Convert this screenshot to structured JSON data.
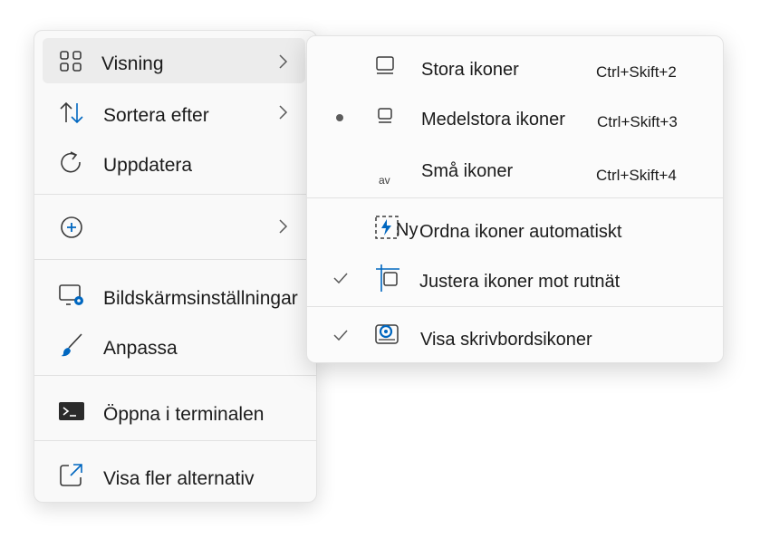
{
  "main_menu": {
    "items": [
      {
        "label": "Visning",
        "icon": "grid-icon",
        "submenu": true,
        "highlighted": true
      },
      {
        "label": "Sortera efter",
        "icon": "sort-arrows-icon",
        "submenu": true
      },
      {
        "label": "Uppdatera",
        "icon": "refresh-icon"
      },
      {
        "label": "",
        "icon": "plus-circle-icon",
        "submenu": true
      },
      {
        "label": "Bildskärmsinställningar",
        "icon": "display-settings-icon"
      },
      {
        "label": "Anpassa",
        "icon": "brush-icon"
      },
      {
        "label": "Öppna i terminalen",
        "icon": "terminal-icon"
      },
      {
        "label": "Visa fler alternativ",
        "icon": "external-link-icon"
      }
    ]
  },
  "sub_menu": {
    "items": [
      {
        "label": "Stora ikoner",
        "shortcut": "Ctrl+Skift+2",
        "icon": "large-icons-icon",
        "selected": false
      },
      {
        "label": "Medelstora ikoner",
        "shortcut": "Ctrl+Skift+3",
        "icon": "medium-icons-icon",
        "selected": true
      },
      {
        "label": "Små ikoner",
        "shortcut": "Ctrl+Skift+4",
        "icon": "small-icons-icon",
        "icon_text": "av",
        "selected": false
      },
      {
        "label": "Ordna ikoner automatiskt",
        "icon": "auto-arrange-icon",
        "overlay_text": "Ny",
        "checked": false
      },
      {
        "label": "Justera ikoner mot rutnät",
        "icon": "align-grid-icon",
        "checked": true
      },
      {
        "label": "Visa skrivbordsikoner",
        "icon": "show-desktop-icons-icon",
        "checked": true
      }
    ]
  },
  "colors": {
    "accent": "#0067c0",
    "text": "#1b1b1b",
    "menu_bg": "#f9f9f9",
    "hover": "#ececec"
  }
}
